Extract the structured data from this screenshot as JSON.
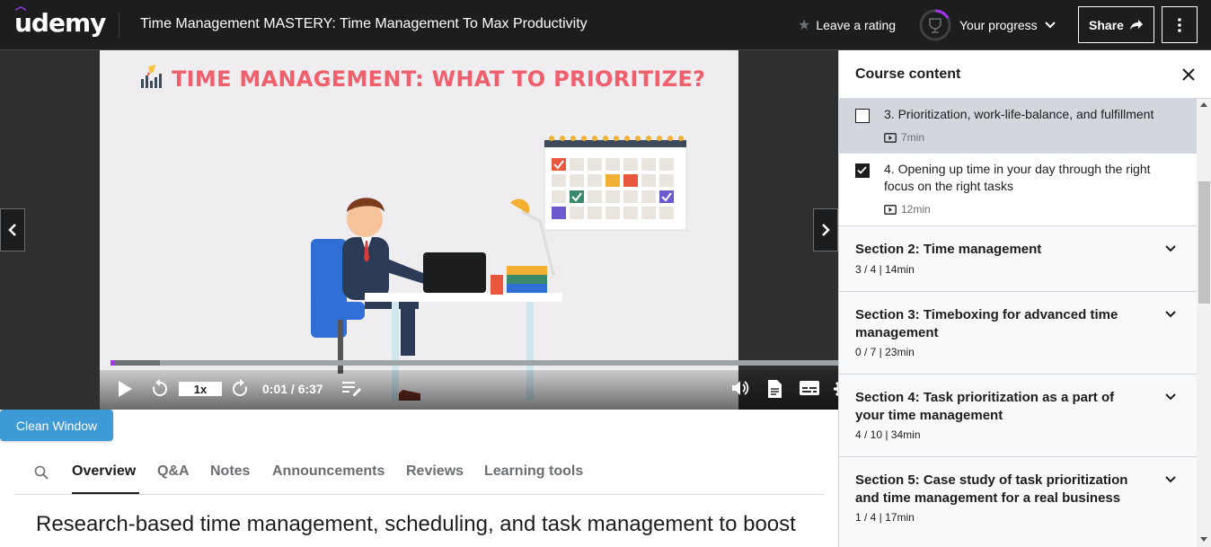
{
  "header": {
    "logo": "udemy",
    "course_title": "Time Management MASTERY: Time Management To Max Productivity",
    "leave_rating": "Leave a rating",
    "your_progress": "Your progress",
    "share": "Share"
  },
  "video": {
    "slide_title": "TIME MANAGEMENT: WHAT TO PRIORITIZE?",
    "speed": "1x",
    "time": "0:01 / 6:37",
    "progress_fraction": 0.003,
    "buffer_fraction": 0.06
  },
  "clean_window": "Clean Window",
  "tabs": {
    "items": [
      "Overview",
      "Q&A",
      "Notes",
      "Announcements",
      "Reviews",
      "Learning tools"
    ],
    "active": "Overview"
  },
  "overview_heading": "Research-based time management, scheduling, and task management to boost",
  "sidebar": {
    "title": "Course content",
    "lectures": [
      {
        "title": "3. Prioritization, work-life-balance, and fulfillment",
        "duration": "7min",
        "checked": false,
        "current": true
      },
      {
        "title": "4. Opening up time in your day through the right focus on the right tasks",
        "duration": "12min",
        "checked": true,
        "current": false
      }
    ],
    "sections": [
      {
        "title": "Section 2: Time management",
        "meta": "3 / 4 | 14min"
      },
      {
        "title": "Section 3: Timeboxing for advanced time management",
        "meta": "0 / 7 | 23min"
      },
      {
        "title": "Section 4: Task prioritization as a part of your time management",
        "meta": "4 / 10 | 34min"
      },
      {
        "title": "Section 5: Case study of task prioritization and time management for a real business",
        "meta": "1 / 4 | 17min"
      }
    ]
  },
  "colors": {
    "brand": "#a435f0",
    "header_bg": "#1c1d1f",
    "clean_button": "#3d9ad6",
    "slide_title": "#ef5f6c"
  }
}
